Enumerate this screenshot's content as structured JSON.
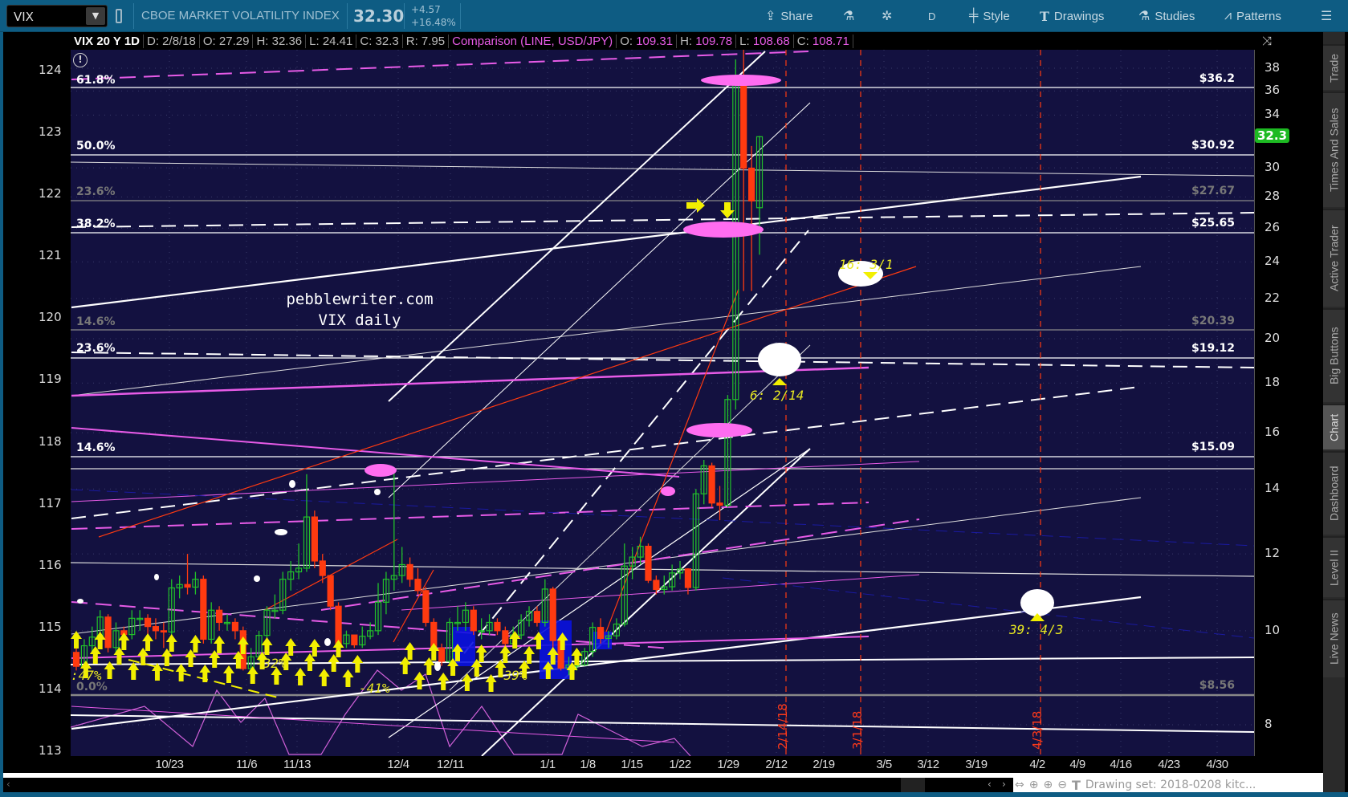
{
  "toolbar": {
    "symbol": "VIX",
    "description": "CBOE MARKET VOLATILITY INDEX",
    "last": "32.30",
    "change": "+4.57",
    "change_pct": "+16.48%",
    "share": "Share",
    "aggregation": "D",
    "style": "Style",
    "drawings": "Drawings",
    "studies": "Studies",
    "patterns": "Patterns"
  },
  "infobar": {
    "title": "VIX 20 Y 1D",
    "date": "D: 2/8/18",
    "open": "O: 27.29",
    "high": "H: 32.36",
    "low": "L: 24.41",
    "close": "C: 32.3",
    "range": "R: 7.95",
    "comparison": "Comparison (LINE, USD/JPY)",
    "cmp_open_label": "O:",
    "cmp_open": "109.31",
    "cmp_high_label": "H:",
    "cmp_high": "109.78",
    "cmp_low_label": "L:",
    "cmp_low": "108.68",
    "cmp_close_label": "C:",
    "cmp_close": "108.71"
  },
  "sidebar": [
    "Trade",
    "Times And Sales",
    "Active Trader",
    "Big Buttons",
    "Chart",
    "Dashboard",
    "Level II",
    "Live News"
  ],
  "left_axis": [
    "124",
    "123",
    "122",
    "121",
    "120",
    "119",
    "118",
    "117",
    "116",
    "115",
    "114",
    "113"
  ],
  "right_axis": [
    "38",
    "36",
    "34",
    "30",
    "28",
    "26",
    "24",
    "22",
    "20",
    "18",
    "16",
    "14",
    "12",
    "10",
    "8"
  ],
  "price_tag": "32.3",
  "date_axis": [
    "10/23",
    "11/6",
    "11/13",
    "12/4",
    "12/11",
    "1/1",
    "1/8",
    "1/15",
    "1/22",
    "1/29",
    "2/12",
    "2/19",
    "3/5",
    "3/12",
    "3/19",
    "4/2",
    "4/9",
    "4/16",
    "4/23",
    "4/30"
  ],
  "fib_levels": [
    {
      "pct": "61.8%",
      "value": "$36.2"
    },
    {
      "pct": "50.0%",
      "value": "$30.92"
    },
    {
      "pct": "23.6%",
      "value": "$27.67"
    },
    {
      "pct": "38.2%",
      "value": "$25.65"
    },
    {
      "pct": "14.6%",
      "value": "$20.39"
    },
    {
      "pct": "23.6%",
      "value": "$19.12"
    },
    {
      "pct": "14.6%",
      "value": "$15.09"
    },
    {
      "pct": "0.0%",
      "value": "$8.56"
    }
  ],
  "watermark": {
    "line1": "pebblewriter.com",
    "line2": "VIX daily"
  },
  "annotations": {
    "target1": "16: 3/1",
    "target2": "6: 2/14",
    "target3": "39: 4/3",
    "drop1": "-41%",
    "drop2": "-39%",
    "drop3": "-32%",
    "drop4": ":47%",
    "vline1": "2/14/18",
    "vline2": "3/1/18",
    "vline3": "4/3/18"
  },
  "status": {
    "drawing_set": "Drawing set: 2018-0208 kitc..."
  },
  "colors": {
    "up": "#22c02a",
    "down": "#ff3a10",
    "chart_bg": "#131140",
    "fib": "#ffffff",
    "magenta": "#e75be7",
    "signal": "#f2ef00"
  },
  "chart_data": {
    "type": "candlestick",
    "title": "VIX 20 Y 1D",
    "yscale": "log",
    "ylim": [
      7.6,
      39.5
    ],
    "candles": [
      [
        9.5,
        9.8,
        9.1,
        9.19
      ],
      [
        9.19,
        9.8,
        9.1,
        9.65
      ],
      [
        9.65,
        10.1,
        9.5,
        9.85
      ],
      [
        9.85,
        10.5,
        9.7,
        10.33
      ],
      [
        10.33,
        10.4,
        9.5,
        9.61
      ],
      [
        9.61,
        10.2,
        9.5,
        10.0
      ],
      [
        10.0,
        10.1,
        9.7,
        9.91
      ],
      [
        9.91,
        10.5,
        9.8,
        10.3
      ],
      [
        10.3,
        10.5,
        10.0,
        10.3
      ],
      [
        10.3,
        10.4,
        9.9,
        10.1
      ],
      [
        10.1,
        10.3,
        9.8,
        10.0
      ],
      [
        10.0,
        10.2,
        9.6,
        9.97
      ],
      [
        9.97,
        11.3,
        9.9,
        11.07
      ],
      [
        11.07,
        11.4,
        10.8,
        11.16
      ],
      [
        11.16,
        12.0,
        10.9,
        11.09
      ],
      [
        11.09,
        11.5,
        10.9,
        11.3
      ],
      [
        11.3,
        11.4,
        9.7,
        9.8
      ],
      [
        9.8,
        10.7,
        9.7,
        10.5
      ],
      [
        10.5,
        10.6,
        10.0,
        10.2
      ],
      [
        10.2,
        10.4,
        10.0,
        10.2
      ],
      [
        10.2,
        10.3,
        9.8,
        10.0
      ],
      [
        10.0,
        10.1,
        9.1,
        9.14
      ],
      [
        9.14,
        9.6,
        9.1,
        9.4
      ],
      [
        9.4,
        10.0,
        9.3,
        9.89
      ],
      [
        9.89,
        10.6,
        9.8,
        10.5
      ],
      [
        10.5,
        10.9,
        10.3,
        10.5
      ],
      [
        10.5,
        11.5,
        10.4,
        11.3
      ],
      [
        11.3,
        11.8,
        11.0,
        11.5
      ],
      [
        11.5,
        12.3,
        11.3,
        11.6
      ],
      [
        11.6,
        14.5,
        11.5,
        13.1
      ],
      [
        13.1,
        13.3,
        11.6,
        11.8
      ],
      [
        11.8,
        12.0,
        11.2,
        11.4
      ],
      [
        11.4,
        11.4,
        10.5,
        10.6
      ],
      [
        10.6,
        10.7,
        9.6,
        9.7
      ],
      [
        9.7,
        10.0,
        9.6,
        9.9
      ],
      [
        9.9,
        9.9,
        9.6,
        9.67
      ],
      [
        9.67,
        10.1,
        9.6,
        9.87
      ],
      [
        9.87,
        10.2,
        9.8,
        10.0
      ],
      [
        10.0,
        11.2,
        9.9,
        10.7
      ],
      [
        10.7,
        11.5,
        10.4,
        11.3
      ],
      [
        11.3,
        14.6,
        11.0,
        11.4
      ],
      [
        11.4,
        12.2,
        11.2,
        11.7
      ],
      [
        11.7,
        11.9,
        11.1,
        11.3
      ],
      [
        11.3,
        11.6,
        10.9,
        11.0
      ],
      [
        11.0,
        11.1,
        10.1,
        10.2
      ],
      [
        10.2,
        10.3,
        9.5,
        9.6
      ],
      [
        9.6,
        9.7,
        9.2,
        9.3
      ],
      [
        9.3,
        10.3,
        9.2,
        10.2
      ],
      [
        10.2,
        10.6,
        10.0,
        10.2
      ],
      [
        10.2,
        10.7,
        10.0,
        10.5
      ],
      [
        10.5,
        10.6,
        9.9,
        10.0
      ],
      [
        10.0,
        10.3,
        9.8,
        10.0
      ],
      [
        10.0,
        10.4,
        9.9,
        10.2
      ],
      [
        10.2,
        10.3,
        9.9,
        10.0
      ],
      [
        10.0,
        10.1,
        9.6,
        9.7
      ],
      [
        9.7,
        10.1,
        9.6,
        9.9
      ],
      [
        9.9,
        10.4,
        9.8,
        10.25
      ],
      [
        10.25,
        10.6,
        10.1,
        10.47
      ],
      [
        10.47,
        10.6,
        10.1,
        10.2
      ],
      [
        10.2,
        11.3,
        10.1,
        11.04
      ],
      [
        11.04,
        11.1,
        9.6,
        9.77
      ],
      [
        9.77,
        9.9,
        9.1,
        9.15
      ],
      [
        9.15,
        9.4,
        9.0,
        9.22
      ],
      [
        9.22,
        9.4,
        9.1,
        9.22
      ],
      [
        9.22,
        9.6,
        9.2,
        9.52
      ],
      [
        9.52,
        10.2,
        9.4,
        10.08
      ],
      [
        10.08,
        10.3,
        9.7,
        9.82
      ],
      [
        9.82,
        10.0,
        9.6,
        9.88
      ],
      [
        9.88,
        10.3,
        9.8,
        10.16
      ],
      [
        10.16,
        12.3,
        10.1,
        11.66
      ],
      [
        11.66,
        12.2,
        11.3,
        11.91
      ],
      [
        11.91,
        12.5,
        11.7,
        12.22
      ],
      [
        12.22,
        12.3,
        11.2,
        11.27
      ],
      [
        11.27,
        11.4,
        10.9,
        11.03
      ],
      [
        11.03,
        11.4,
        10.9,
        11.1
      ],
      [
        11.1,
        11.7,
        11.0,
        11.47
      ],
      [
        11.47,
        11.8,
        11.3,
        11.58
      ],
      [
        11.58,
        11.6,
        10.9,
        11.08
      ],
      [
        11.08,
        14.0,
        11.0,
        13.84
      ],
      [
        13.84,
        15.0,
        13.5,
        14.79
      ],
      [
        14.79,
        14.9,
        13.4,
        13.54
      ],
      [
        13.54,
        14.1,
        13.0,
        13.47
      ],
      [
        13.47,
        17.5,
        13.4,
        17.31
      ],
      [
        17.31,
        38.8,
        16.9,
        37.32
      ],
      [
        37.32,
        50.3,
        22.4,
        29.98
      ],
      [
        29.98,
        31.6,
        22.4,
        27.73
      ],
      [
        27.29,
        32.36,
        24.41,
        32.3
      ]
    ]
  }
}
